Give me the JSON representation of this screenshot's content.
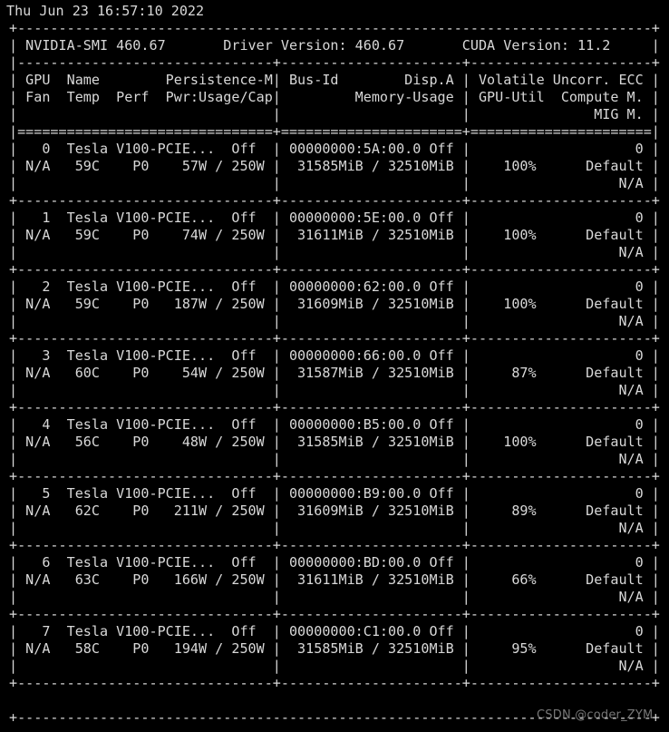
{
  "terminal": {
    "background_color": "#000000",
    "text_color": "#d8d8d8",
    "timestamp": "Thu Jun 23 16:57:10 2022"
  },
  "header": {
    "smi_label": "NVIDIA-SMI",
    "smi_version": "460.67",
    "driver_label": "Driver Version:",
    "driver_version": "460.67",
    "cuda_label": "CUDA Version:",
    "cuda_version": "11.2"
  },
  "columns": {
    "row1": [
      "GPU",
      "Name",
      "Persistence-M",
      "Bus-Id",
      "Disp.A",
      "Volatile Uncorr. ECC"
    ],
    "row2": [
      "Fan",
      "Temp",
      "Perf",
      "Pwr:Usage/Cap",
      "Memory-Usage",
      "GPU-Util",
      "Compute M."
    ],
    "row3": [
      "MIG M."
    ]
  },
  "gpus": [
    {
      "index": "0",
      "name": "Tesla V100-PCIE...",
      "persistence_m": "Off",
      "bus_id": "00000000:5A:00.0",
      "disp_a": "Off",
      "ecc": "0",
      "fan": "N/A",
      "temp": "59C",
      "perf": "P0",
      "power_usage": "57W",
      "power_cap": "250W",
      "memory_used": "31585MiB",
      "memory_total": "32510MiB",
      "gpu_util": "100%",
      "compute_m": "Default",
      "mig_m": "N/A"
    },
    {
      "index": "1",
      "name": "Tesla V100-PCIE...",
      "persistence_m": "Off",
      "bus_id": "00000000:5E:00.0",
      "disp_a": "Off",
      "ecc": "0",
      "fan": "N/A",
      "temp": "59C",
      "perf": "P0",
      "power_usage": "74W",
      "power_cap": "250W",
      "memory_used": "31611MiB",
      "memory_total": "32510MiB",
      "gpu_util": "100%",
      "compute_m": "Default",
      "mig_m": "N/A"
    },
    {
      "index": "2",
      "name": "Tesla V100-PCIE...",
      "persistence_m": "Off",
      "bus_id": "00000000:62:00.0",
      "disp_a": "Off",
      "ecc": "0",
      "fan": "N/A",
      "temp": "59C",
      "perf": "P0",
      "power_usage": "187W",
      "power_cap": "250W",
      "memory_used": "31609MiB",
      "memory_total": "32510MiB",
      "gpu_util": "100%",
      "compute_m": "Default",
      "mig_m": "N/A"
    },
    {
      "index": "3",
      "name": "Tesla V100-PCIE...",
      "persistence_m": "Off",
      "bus_id": "00000000:66:00.0",
      "disp_a": "Off",
      "ecc": "0",
      "fan": "N/A",
      "temp": "60C",
      "perf": "P0",
      "power_usage": "54W",
      "power_cap": "250W",
      "memory_used": "31587MiB",
      "memory_total": "32510MiB",
      "gpu_util": "87%",
      "compute_m": "Default",
      "mig_m": "N/A"
    },
    {
      "index": "4",
      "name": "Tesla V100-PCIE...",
      "persistence_m": "Off",
      "bus_id": "00000000:B5:00.0",
      "disp_a": "Off",
      "ecc": "0",
      "fan": "N/A",
      "temp": "56C",
      "perf": "P0",
      "power_usage": "48W",
      "power_cap": "250W",
      "memory_used": "31585MiB",
      "memory_total": "32510MiB",
      "gpu_util": "100%",
      "compute_m": "Default",
      "mig_m": "N/A"
    },
    {
      "index": "5",
      "name": "Tesla V100-PCIE...",
      "persistence_m": "Off",
      "bus_id": "00000000:B9:00.0",
      "disp_a": "Off",
      "ecc": "0",
      "fan": "N/A",
      "temp": "62C",
      "perf": "P0",
      "power_usage": "211W",
      "power_cap": "250W",
      "memory_used": "31609MiB",
      "memory_total": "32510MiB",
      "gpu_util": "89%",
      "compute_m": "Default",
      "mig_m": "N/A"
    },
    {
      "index": "6",
      "name": "Tesla V100-PCIE...",
      "persistence_m": "Off",
      "bus_id": "00000000:BD:00.0",
      "disp_a": "Off",
      "ecc": "0",
      "fan": "N/A",
      "temp": "63C",
      "perf": "P0",
      "power_usage": "166W",
      "power_cap": "250W",
      "memory_used": "31611MiB",
      "memory_total": "32510MiB",
      "gpu_util": "66%",
      "compute_m": "Default",
      "mig_m": "N/A"
    },
    {
      "index": "7",
      "name": "Tesla V100-PCIE...",
      "persistence_m": "Off",
      "bus_id": "00000000:C1:00.0",
      "disp_a": "Off",
      "ecc": "0",
      "fan": "N/A",
      "temp": "58C",
      "perf": "P0",
      "power_usage": "194W",
      "power_cap": "250W",
      "memory_used": "31585MiB",
      "memory_total": "32510MiB",
      "gpu_util": "95%",
      "compute_m": "Default",
      "mig_m": "N/A"
    }
  ],
  "lines": {
    "l00": "Thu Jun 23 16:57:10 2022",
    "l01": "+-----------------------------------------------------------------------------+",
    "l02": "| NVIDIA-SMI 460.67       Driver Version: 460.67       CUDA Version: 11.2     |",
    "l03": "|-------------------------------+----------------------+----------------------+",
    "l04": "| GPU  Name        Persistence-M| Bus-Id        Disp.A | Volatile Uncorr. ECC |",
    "l05": "| Fan  Temp  Perf  Pwr:Usage/Cap|         Memory-Usage | GPU-Util  Compute M. |",
    "l06": "|                               |                      |               MIG M. |",
    "l07": "|===============================+======================+======================|",
    "l08": "|   0  Tesla V100-PCIE...  Off  | 00000000:5A:00.0 Off |                    0 |",
    "l09": "| N/A   59C    P0    57W / 250W |  31585MiB / 32510MiB |    100%      Default |",
    "l10": "|                               |                      |                  N/A |",
    "l11": "+-------------------------------+----------------------+----------------------+",
    "l12": "|   1  Tesla V100-PCIE...  Off  | 00000000:5E:00.0 Off |                    0 |",
    "l13": "| N/A   59C    P0    74W / 250W |  31611MiB / 32510MiB |    100%      Default |",
    "l14": "|                               |                      |                  N/A |",
    "l15": "+-------------------------------+----------------------+----------------------+",
    "l16": "|   2  Tesla V100-PCIE...  Off  | 00000000:62:00.0 Off |                    0 |",
    "l17": "| N/A   59C    P0   187W / 250W |  31609MiB / 32510MiB |    100%      Default |",
    "l18": "|                               |                      |                  N/A |",
    "l19": "+-------------------------------+----------------------+----------------------+",
    "l20": "|   3  Tesla V100-PCIE...  Off  | 00000000:66:00.0 Off |                    0 |",
    "l21": "| N/A   60C    P0    54W / 250W |  31587MiB / 32510MiB |     87%      Default |",
    "l22": "|                               |                      |                  N/A |",
    "l23": "+-------------------------------+----------------------+----------------------+",
    "l24": "|   4  Tesla V100-PCIE...  Off  | 00000000:B5:00.0 Off |                    0 |",
    "l25": "| N/A   56C    P0    48W / 250W |  31585MiB / 32510MiB |    100%      Default |",
    "l26": "|                               |                      |                  N/A |",
    "l27": "+-------------------------------+----------------------+----------------------+",
    "l28": "|   5  Tesla V100-PCIE...  Off  | 00000000:B9:00.0 Off |                    0 |",
    "l29": "| N/A   62C    P0   211W / 250W |  31609MiB / 32510MiB |     89%      Default |",
    "l30": "|                               |                      |                  N/A |",
    "l31": "+-------------------------------+----------------------+----------------------+",
    "l32": "|   6  Tesla V100-PCIE...  Off  | 00000000:BD:00.0 Off |                    0 |",
    "l33": "| N/A   63C    P0   166W / 250W |  31611MiB / 32510MiB |     66%      Default |",
    "l34": "|                               |                      |                  N/A |",
    "l35": "+-------------------------------+----------------------+----------------------+",
    "l36": "|   7  Tesla V100-PCIE...  Off  | 00000000:C1:00.0 Off |                    0 |",
    "l37": "| N/A   58C    P0   194W / 250W |  31585MiB / 32510MiB |     95%      Default |",
    "l38": "|                               |                      |                  N/A |",
    "l39": "+-------------------------------+----------------------+----------------------+",
    "l40": " ",
    "l41": "+-----------------------------------------------------------------------------+"
  },
  "watermark": {
    "text": "CSDN @coder_ZYM"
  }
}
